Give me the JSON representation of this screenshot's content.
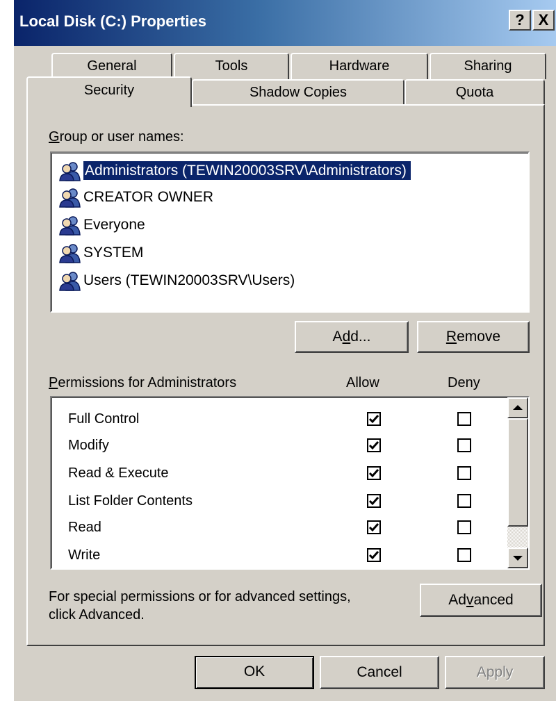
{
  "window": {
    "title": "Local Disk (C:) Properties",
    "help_label": "?",
    "close_label": "X"
  },
  "tabs": [
    {
      "label": "General",
      "active": false
    },
    {
      "label": "Tools",
      "active": false
    },
    {
      "label": "Hardware",
      "active": false
    },
    {
      "label": "Sharing",
      "active": false
    },
    {
      "label": "Security",
      "active": true
    },
    {
      "label": "Shadow Copies",
      "active": false
    },
    {
      "label": "Quota",
      "active": false
    }
  ],
  "security": {
    "group_label_prefix": "G",
    "group_label_rest": "roup or user names:",
    "users": [
      {
        "name": "Administrators (TEWIN20003SRV\\Administrators)",
        "selected": true
      },
      {
        "name": "CREATOR OWNER",
        "selected": false
      },
      {
        "name": "Everyone",
        "selected": false
      },
      {
        "name": "SYSTEM",
        "selected": false
      },
      {
        "name": "Users (TEWIN20003SRV\\Users)",
        "selected": false
      }
    ],
    "add_button": {
      "pre": "A",
      "key": "d",
      "post": "d..."
    },
    "remove_button": {
      "pre": "",
      "key": "R",
      "post": "emove"
    },
    "permissions_label_key": "P",
    "permissions_label_rest": "ermissions for Administrators",
    "allow_header": "Allow",
    "deny_header": "Deny",
    "permissions": [
      {
        "name": "Full Control",
        "allow": true,
        "deny": false
      },
      {
        "name": "Modify",
        "allow": true,
        "deny": false
      },
      {
        "name": "Read & Execute",
        "allow": true,
        "deny": false
      },
      {
        "name": "List Folder Contents",
        "allow": true,
        "deny": false
      },
      {
        "name": "Read",
        "allow": true,
        "deny": false
      },
      {
        "name": "Write",
        "allow": true,
        "deny": false
      }
    ],
    "advanced_note_line1": "For special permissions or for advanced settings,",
    "advanced_note_line2": "click Advanced.",
    "advanced_button": {
      "pre": "Ad",
      "key": "v",
      "post": "anced"
    }
  },
  "footer": {
    "ok_label": "OK",
    "cancel_label": "Cancel",
    "apply_label": "Apply",
    "apply_enabled": false
  },
  "colors": {
    "dialog_face": "#d4d0c8",
    "selection": "#0a246a",
    "title_start": "#0a246a",
    "title_end": "#a6caf0"
  },
  "icons": {
    "user_group": "user-group-icon",
    "check": "check-icon",
    "scroll_up": "scroll-up-arrow-icon",
    "scroll_down": "scroll-down-arrow-icon"
  }
}
